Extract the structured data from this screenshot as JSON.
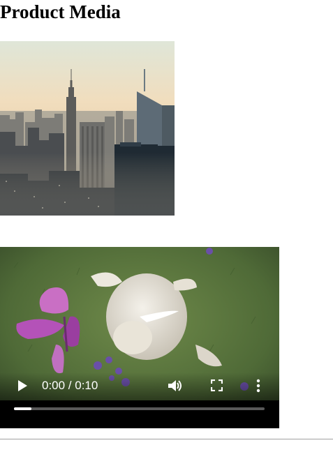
{
  "page": {
    "heading": "Product Media"
  },
  "image": {
    "subject": "city-skyline"
  },
  "video": {
    "time_display": "0:00 / 0:10",
    "progress": 0.07,
    "controls": {
      "play_icon": "play-icon",
      "volume_icon": "volume-icon",
      "fullscreen_icon": "fullscreen-icon",
      "more_icon": "more-options-icon"
    }
  },
  "colors": {
    "text": "#000000",
    "video_control": "#ffffff",
    "divider": "#a0a0a0"
  }
}
